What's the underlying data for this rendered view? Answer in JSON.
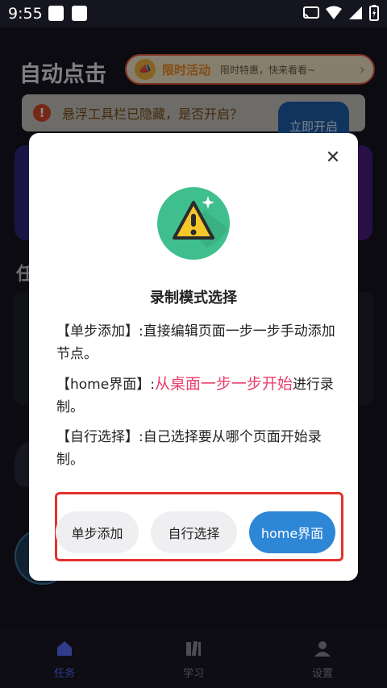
{
  "status": {
    "time": "9:55"
  },
  "app": {
    "title": "自动点击",
    "promo": {
      "tag": "限时活动",
      "text": "限时特惠，快来看看~"
    },
    "notice": {
      "text": "悬浮工具栏已隐藏，是否开启？",
      "button": "立即开启"
    },
    "section_heading_fragment": "任"
  },
  "nav": [
    {
      "label": "任务",
      "icon": "home-icon"
    },
    {
      "label": "学习",
      "icon": "book-icon"
    },
    {
      "label": "设置",
      "icon": "person-icon"
    }
  ],
  "dialog": {
    "title": "录制模式选择",
    "lines": [
      {
        "pre": "【单步添加】:直接编辑页面一步一步手动添加节点。",
        "hl": "",
        "post": ""
      },
      {
        "pre": "【home界面】:",
        "hl": "从桌面一步一步开始",
        "post": "进行录制。"
      },
      {
        "pre": "【自行选择】:自己选择要从哪个页面开始录制。",
        "hl": "",
        "post": ""
      }
    ],
    "buttons": {
      "single_step": "单步添加",
      "custom": "自行选择",
      "home": "home界面"
    }
  },
  "colors": {
    "accent_blue": "#2e86d6",
    "highlight_pink": "#ea3f6c",
    "selection_red": "#e2332c"
  }
}
